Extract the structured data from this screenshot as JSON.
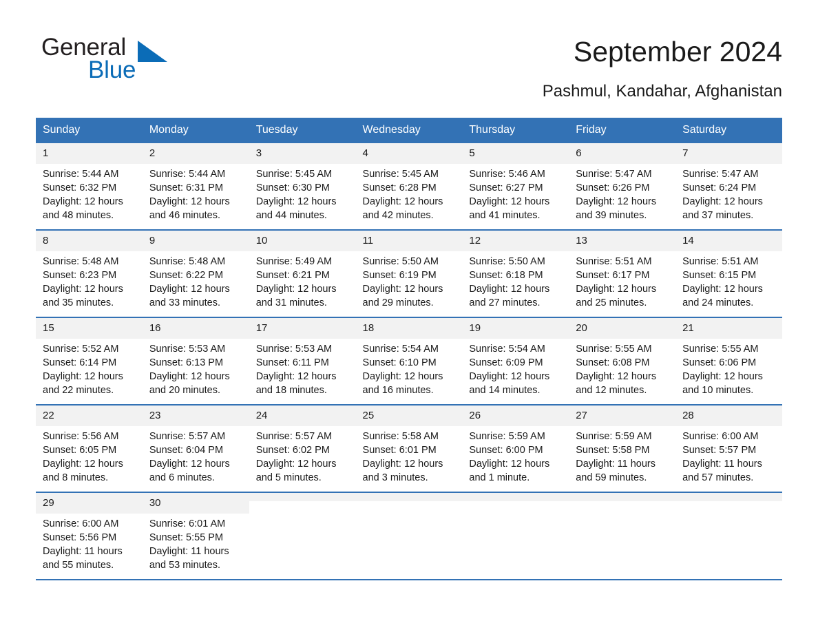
{
  "logo": {
    "word1": "General",
    "word2": "Blue",
    "triangle_color": "#0b6cb7"
  },
  "header": {
    "title": "September 2024",
    "location": "Pashmul, Kandahar, Afghanistan"
  },
  "theme": {
    "header_blue": "#3372b5",
    "daynum_bg": "#f2f2f2",
    "text": "#1a1a1a"
  },
  "weekday_headers": [
    "Sunday",
    "Monday",
    "Tuesday",
    "Wednesday",
    "Thursday",
    "Friday",
    "Saturday"
  ],
  "weeks": [
    [
      {
        "day": "1",
        "sunrise": "Sunrise: 5:44 AM",
        "sunset": "Sunset: 6:32 PM",
        "daylight_1": "Daylight: 12 hours",
        "daylight_2": "and 48 minutes."
      },
      {
        "day": "2",
        "sunrise": "Sunrise: 5:44 AM",
        "sunset": "Sunset: 6:31 PM",
        "daylight_1": "Daylight: 12 hours",
        "daylight_2": "and 46 minutes."
      },
      {
        "day": "3",
        "sunrise": "Sunrise: 5:45 AM",
        "sunset": "Sunset: 6:30 PM",
        "daylight_1": "Daylight: 12 hours",
        "daylight_2": "and 44 minutes."
      },
      {
        "day": "4",
        "sunrise": "Sunrise: 5:45 AM",
        "sunset": "Sunset: 6:28 PM",
        "daylight_1": "Daylight: 12 hours",
        "daylight_2": "and 42 minutes."
      },
      {
        "day": "5",
        "sunrise": "Sunrise: 5:46 AM",
        "sunset": "Sunset: 6:27 PM",
        "daylight_1": "Daylight: 12 hours",
        "daylight_2": "and 41 minutes."
      },
      {
        "day": "6",
        "sunrise": "Sunrise: 5:47 AM",
        "sunset": "Sunset: 6:26 PM",
        "daylight_1": "Daylight: 12 hours",
        "daylight_2": "and 39 minutes."
      },
      {
        "day": "7",
        "sunrise": "Sunrise: 5:47 AM",
        "sunset": "Sunset: 6:24 PM",
        "daylight_1": "Daylight: 12 hours",
        "daylight_2": "and 37 minutes."
      }
    ],
    [
      {
        "day": "8",
        "sunrise": "Sunrise: 5:48 AM",
        "sunset": "Sunset: 6:23 PM",
        "daylight_1": "Daylight: 12 hours",
        "daylight_2": "and 35 minutes."
      },
      {
        "day": "9",
        "sunrise": "Sunrise: 5:48 AM",
        "sunset": "Sunset: 6:22 PM",
        "daylight_1": "Daylight: 12 hours",
        "daylight_2": "and 33 minutes."
      },
      {
        "day": "10",
        "sunrise": "Sunrise: 5:49 AM",
        "sunset": "Sunset: 6:21 PM",
        "daylight_1": "Daylight: 12 hours",
        "daylight_2": "and 31 minutes."
      },
      {
        "day": "11",
        "sunrise": "Sunrise: 5:50 AM",
        "sunset": "Sunset: 6:19 PM",
        "daylight_1": "Daylight: 12 hours",
        "daylight_2": "and 29 minutes."
      },
      {
        "day": "12",
        "sunrise": "Sunrise: 5:50 AM",
        "sunset": "Sunset: 6:18 PM",
        "daylight_1": "Daylight: 12 hours",
        "daylight_2": "and 27 minutes."
      },
      {
        "day": "13",
        "sunrise": "Sunrise: 5:51 AM",
        "sunset": "Sunset: 6:17 PM",
        "daylight_1": "Daylight: 12 hours",
        "daylight_2": "and 25 minutes."
      },
      {
        "day": "14",
        "sunrise": "Sunrise: 5:51 AM",
        "sunset": "Sunset: 6:15 PM",
        "daylight_1": "Daylight: 12 hours",
        "daylight_2": "and 24 minutes."
      }
    ],
    [
      {
        "day": "15",
        "sunrise": "Sunrise: 5:52 AM",
        "sunset": "Sunset: 6:14 PM",
        "daylight_1": "Daylight: 12 hours",
        "daylight_2": "and 22 minutes."
      },
      {
        "day": "16",
        "sunrise": "Sunrise: 5:53 AM",
        "sunset": "Sunset: 6:13 PM",
        "daylight_1": "Daylight: 12 hours",
        "daylight_2": "and 20 minutes."
      },
      {
        "day": "17",
        "sunrise": "Sunrise: 5:53 AM",
        "sunset": "Sunset: 6:11 PM",
        "daylight_1": "Daylight: 12 hours",
        "daylight_2": "and 18 minutes."
      },
      {
        "day": "18",
        "sunrise": "Sunrise: 5:54 AM",
        "sunset": "Sunset: 6:10 PM",
        "daylight_1": "Daylight: 12 hours",
        "daylight_2": "and 16 minutes."
      },
      {
        "day": "19",
        "sunrise": "Sunrise: 5:54 AM",
        "sunset": "Sunset: 6:09 PM",
        "daylight_1": "Daylight: 12 hours",
        "daylight_2": "and 14 minutes."
      },
      {
        "day": "20",
        "sunrise": "Sunrise: 5:55 AM",
        "sunset": "Sunset: 6:08 PM",
        "daylight_1": "Daylight: 12 hours",
        "daylight_2": "and 12 minutes."
      },
      {
        "day": "21",
        "sunrise": "Sunrise: 5:55 AM",
        "sunset": "Sunset: 6:06 PM",
        "daylight_1": "Daylight: 12 hours",
        "daylight_2": "and 10 minutes."
      }
    ],
    [
      {
        "day": "22",
        "sunrise": "Sunrise: 5:56 AM",
        "sunset": "Sunset: 6:05 PM",
        "daylight_1": "Daylight: 12 hours",
        "daylight_2": "and 8 minutes."
      },
      {
        "day": "23",
        "sunrise": "Sunrise: 5:57 AM",
        "sunset": "Sunset: 6:04 PM",
        "daylight_1": "Daylight: 12 hours",
        "daylight_2": "and 6 minutes."
      },
      {
        "day": "24",
        "sunrise": "Sunrise: 5:57 AM",
        "sunset": "Sunset: 6:02 PM",
        "daylight_1": "Daylight: 12 hours",
        "daylight_2": "and 5 minutes."
      },
      {
        "day": "25",
        "sunrise": "Sunrise: 5:58 AM",
        "sunset": "Sunset: 6:01 PM",
        "daylight_1": "Daylight: 12 hours",
        "daylight_2": "and 3 minutes."
      },
      {
        "day": "26",
        "sunrise": "Sunrise: 5:59 AM",
        "sunset": "Sunset: 6:00 PM",
        "daylight_1": "Daylight: 12 hours",
        "daylight_2": "and 1 minute."
      },
      {
        "day": "27",
        "sunrise": "Sunrise: 5:59 AM",
        "sunset": "Sunset: 5:58 PM",
        "daylight_1": "Daylight: 11 hours",
        "daylight_2": "and 59 minutes."
      },
      {
        "day": "28",
        "sunrise": "Sunrise: 6:00 AM",
        "sunset": "Sunset: 5:57 PM",
        "daylight_1": "Daylight: 11 hours",
        "daylight_2": "and 57 minutes."
      }
    ],
    [
      {
        "day": "29",
        "sunrise": "Sunrise: 6:00 AM",
        "sunset": "Sunset: 5:56 PM",
        "daylight_1": "Daylight: 11 hours",
        "daylight_2": "and 55 minutes."
      },
      {
        "day": "30",
        "sunrise": "Sunrise: 6:01 AM",
        "sunset": "Sunset: 5:55 PM",
        "daylight_1": "Daylight: 11 hours",
        "daylight_2": "and 53 minutes."
      },
      {
        "day": "",
        "sunrise": "",
        "sunset": "",
        "daylight_1": "",
        "daylight_2": "",
        "empty": true
      },
      {
        "day": "",
        "sunrise": "",
        "sunset": "",
        "daylight_1": "",
        "daylight_2": "",
        "empty": true
      },
      {
        "day": "",
        "sunrise": "",
        "sunset": "",
        "daylight_1": "",
        "daylight_2": "",
        "empty": true
      },
      {
        "day": "",
        "sunrise": "",
        "sunset": "",
        "daylight_1": "",
        "daylight_2": "",
        "empty": true
      },
      {
        "day": "",
        "sunrise": "",
        "sunset": "",
        "daylight_1": "",
        "daylight_2": "",
        "empty": true
      }
    ]
  ]
}
